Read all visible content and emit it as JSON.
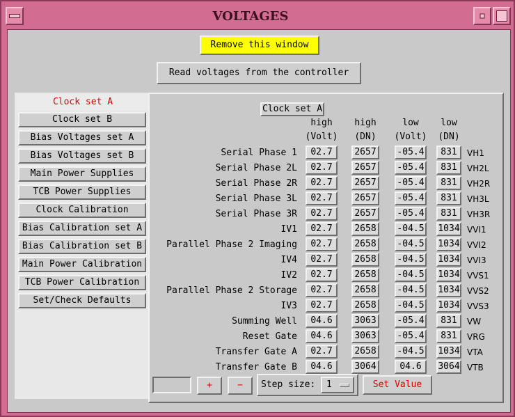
{
  "window": {
    "title": "VOLTAGES",
    "menu_icon": "window-menu-icon",
    "minimize_icon": "minimize-icon",
    "maximize_icon": "maximize-icon"
  },
  "actions": {
    "remove": "Remove this window",
    "read": "Read voltages from the controller"
  },
  "tabs": [
    {
      "label": "Clock set A",
      "active": true
    },
    {
      "label": "Clock set B"
    },
    {
      "label": "Bias Voltages set A"
    },
    {
      "label": "Bias Voltages set B"
    },
    {
      "label": "Main Power Supplies"
    },
    {
      "label": "TCB Power Supplies"
    },
    {
      "label": "Clock Calibration"
    },
    {
      "label": "Bias Calibration set A"
    },
    {
      "label": "Bias Calibration set B"
    },
    {
      "label": "Main Power Calibration"
    },
    {
      "label": "TCB Power Calibration"
    },
    {
      "label": "Set/Check Defaults"
    }
  ],
  "panel": {
    "title": "Clock set A",
    "headers": [
      {
        "line1": "high",
        "line2": "(Volt)"
      },
      {
        "line1": "high",
        "line2": "(DN)"
      },
      {
        "line1": "low",
        "line2": "(Volt)"
      },
      {
        "line1": "low",
        "line2": "(DN)"
      }
    ],
    "rows": [
      {
        "label": "Serial Phase 1",
        "high_volt": "02.7",
        "high_dn": "2657",
        "low_volt": "-05.4",
        "low_dn": "831",
        "code": "VH1"
      },
      {
        "label": "Serial Phase 2L",
        "high_volt": "02.7",
        "high_dn": "2657",
        "low_volt": "-05.4",
        "low_dn": "831",
        "code": "VH2L"
      },
      {
        "label": "Serial Phase 2R",
        "high_volt": "02.7",
        "high_dn": "2657",
        "low_volt": "-05.4",
        "low_dn": "831",
        "code": "VH2R"
      },
      {
        "label": "Serial Phase 3L",
        "high_volt": "02.7",
        "high_dn": "2657",
        "low_volt": "-05.4",
        "low_dn": "831",
        "code": "VH3L"
      },
      {
        "label": "Serial Phase 3R",
        "high_volt": "02.7",
        "high_dn": "2657",
        "low_volt": "-05.4",
        "low_dn": "831",
        "code": "VH3R"
      },
      {
        "label": "IV1",
        "high_volt": "02.7",
        "high_dn": "2658",
        "low_volt": "-04.5",
        "low_dn": "1034",
        "code": "VVI1"
      },
      {
        "label": "Parallel Phase 2 Imaging",
        "high_volt": "02.7",
        "high_dn": "2658",
        "low_volt": "-04.5",
        "low_dn": "1034",
        "code": "VVI2"
      },
      {
        "label": "IV4",
        "high_volt": "02.7",
        "high_dn": "2658",
        "low_volt": "-04.5",
        "low_dn": "1034",
        "code": "VVI3"
      },
      {
        "label": "IV2",
        "high_volt": "02.7",
        "high_dn": "2658",
        "low_volt": "-04.5",
        "low_dn": "1034",
        "code": "VVS1"
      },
      {
        "label": "Parallel Phase 2 Storage",
        "high_volt": "02.7",
        "high_dn": "2658",
        "low_volt": "-04.5",
        "low_dn": "1034",
        "code": "VVS2"
      },
      {
        "label": "IV3",
        "high_volt": "02.7",
        "high_dn": "2658",
        "low_volt": "-04.5",
        "low_dn": "1034",
        "code": "VVS3"
      },
      {
        "label": "Summing Well",
        "high_volt": "04.6",
        "high_dn": "3063",
        "low_volt": "-05.4",
        "low_dn": "831",
        "code": "VW"
      },
      {
        "label": "Reset Gate",
        "high_volt": "04.6",
        "high_dn": "3063",
        "low_volt": "-05.4",
        "low_dn": "831",
        "code": "VRG"
      },
      {
        "label": "Transfer Gate A",
        "high_volt": "02.7",
        "high_dn": "2658",
        "low_volt": "-04.5",
        "low_dn": "1034",
        "code": "VTA"
      },
      {
        "label": "Transfer Gate B",
        "high_volt": "04.6",
        "high_dn": "3064",
        "low_volt": "04.6",
        "low_dn": "3064",
        "code": "VTB"
      }
    ]
  },
  "controls": {
    "value": "",
    "plus": "+",
    "minus": "−",
    "step_label": "Step size:",
    "step_value": "1",
    "set_value": "Set Value"
  }
}
